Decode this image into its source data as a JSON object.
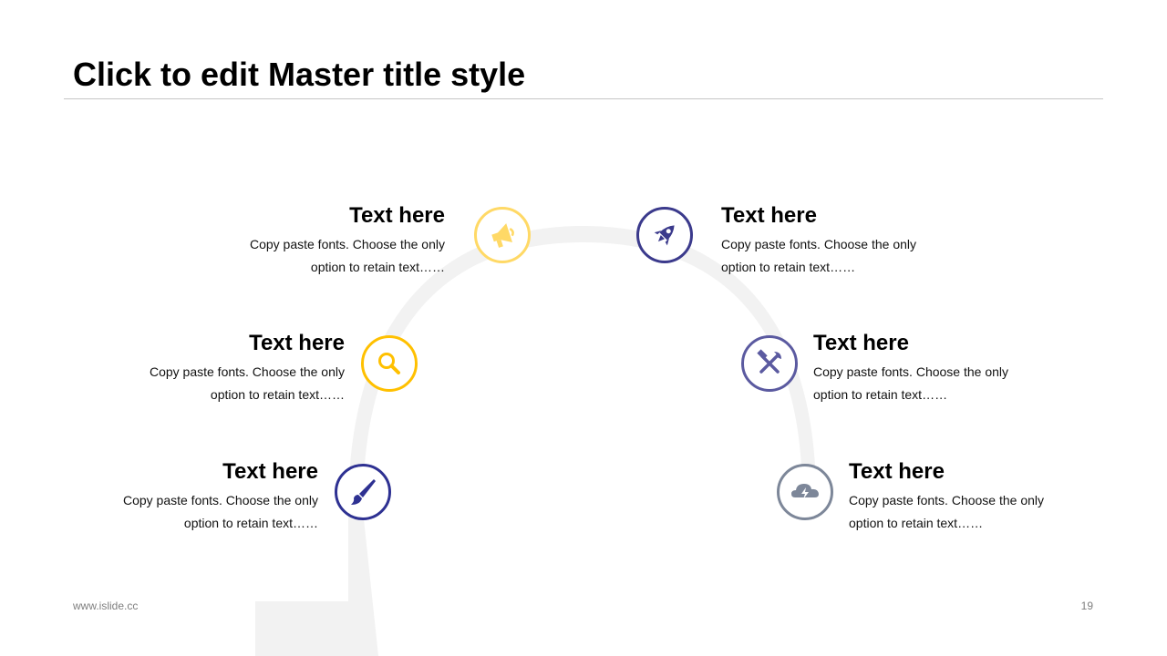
{
  "slide": {
    "title": "Click to edit Master title style",
    "footer_url": "www.islide.cc",
    "page_number": "19"
  },
  "colors": {
    "arc": "#f2f2f2",
    "rule": "#c6c6c6",
    "megaphone": "#ffd966",
    "search": "#ffc000",
    "brush": "#2e3192",
    "rocket": "#3b3a8c",
    "tools": "#5b5aa0",
    "cloud": "#7d8799"
  },
  "items": [
    {
      "title": "Text here",
      "body_line1": "Copy paste fonts. Choose the only",
      "body_line2": "option to retain text……",
      "icon": "megaphone-icon"
    },
    {
      "title": "Text here",
      "body_line1": "Copy paste fonts. Choose the only",
      "body_line2": "option to retain text……",
      "icon": "search-icon"
    },
    {
      "title": "Text here",
      "body_line1": "Copy paste fonts. Choose the only",
      "body_line2": "option to retain text……",
      "icon": "brush-icon"
    },
    {
      "title": "Text here",
      "body_line1": "Copy paste fonts. Choose the only",
      "body_line2": "option to retain text……",
      "icon": "rocket-icon"
    },
    {
      "title": "Text here",
      "body_line1": "Copy paste fonts. Choose the only",
      "body_line2": "option to retain text……",
      "icon": "tools-icon"
    },
    {
      "title": "Text here",
      "body_line1": "Copy paste fonts. Choose the only",
      "body_line2": "option to retain text……",
      "icon": "cloud-icon"
    }
  ]
}
